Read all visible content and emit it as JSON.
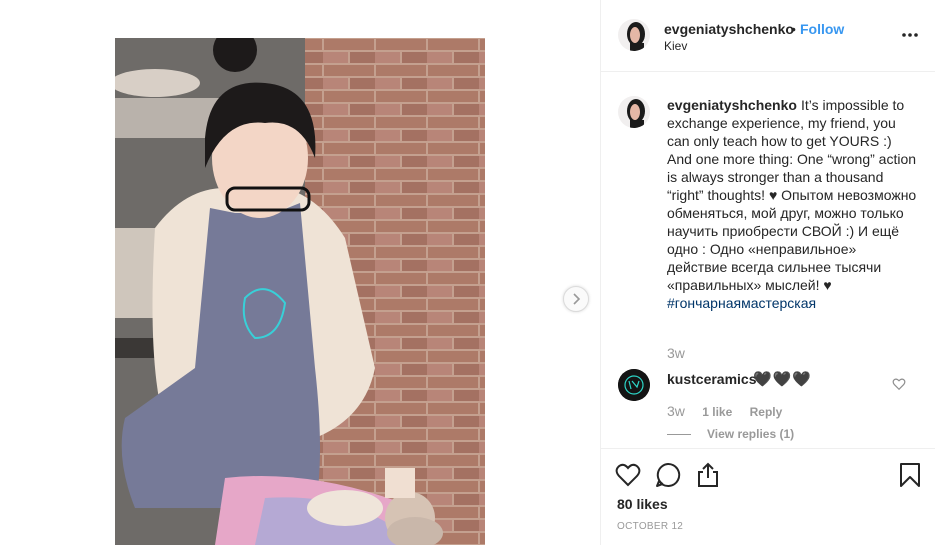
{
  "post": {
    "author": "evgeniatyshchenko",
    "location": "Kiev",
    "follow_label": "Follow",
    "dot": "•"
  },
  "caption": {
    "username": "evgeniatyshchenko",
    "text": "It’s impossible to exchange experience, my friend, you can only teach how to get YOURS :) And one more thing: One “wrong” action is always stronger than a thousand “right” thoughts! ♥ Опытом невозможно обменяться, мой друг, можно только научить приобрести СВОЙ :) И ещё одно : Одно «неправильное» действие всегда сильнее тысячи «правильных» мыслей! ♥",
    "hashtag": "#гончарнаямастерская",
    "time": "3w"
  },
  "comment": {
    "username": "kustceramics",
    "text": "🖤🖤🖤",
    "time": "3w",
    "likes": "1 like",
    "reply_label": "Reply",
    "view_replies": "View replies (1)"
  },
  "footer": {
    "likes": "80 likes",
    "date": "OCTOBER 12"
  },
  "icons": {
    "more": "more-options-icon",
    "next": "chevron-right-icon",
    "like": "heart-icon",
    "comment": "comment-icon",
    "share": "share-icon",
    "save": "bookmark-icon"
  },
  "colors": {
    "link": "#3897f0",
    "hashtag": "#003569",
    "muted": "#999999",
    "text": "#262626",
    "border": "#efefef"
  }
}
